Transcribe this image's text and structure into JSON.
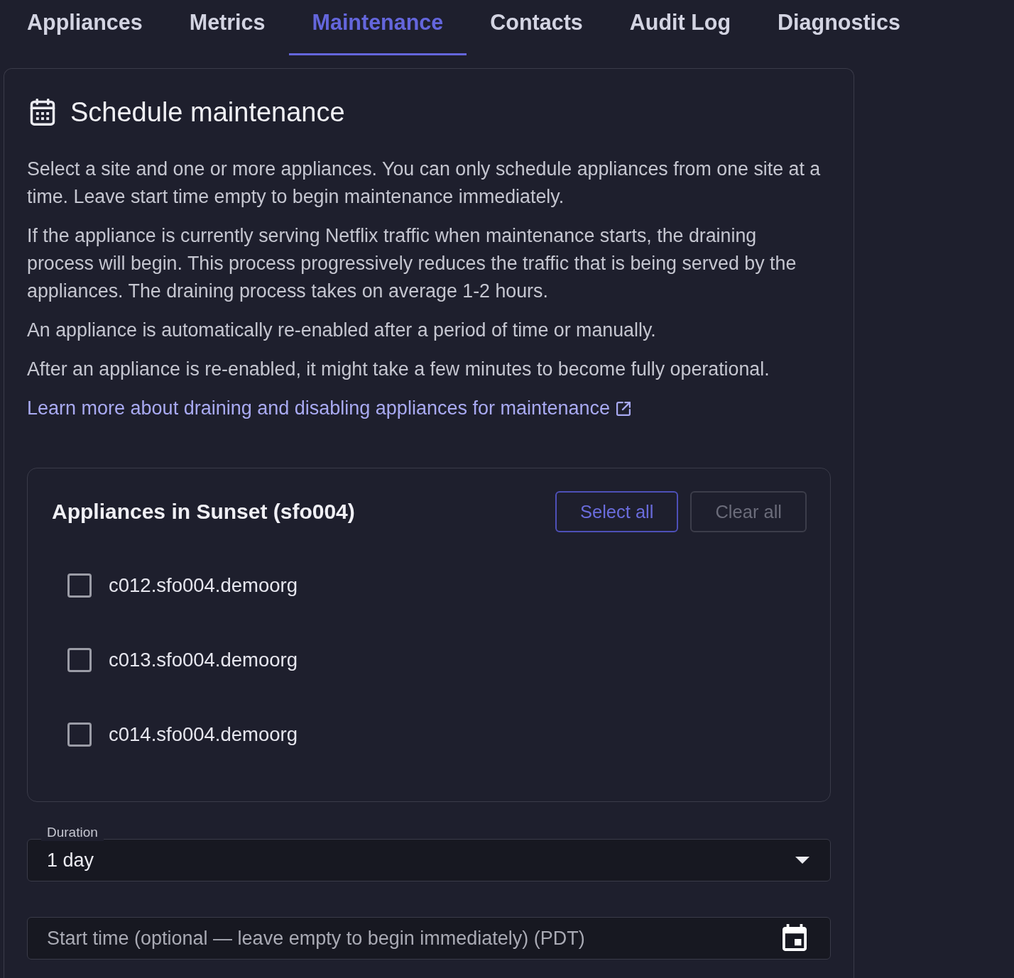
{
  "tabs": [
    {
      "label": "Appliances",
      "selected": false
    },
    {
      "label": "Metrics",
      "selected": false
    },
    {
      "label": "Maintenance",
      "selected": true
    },
    {
      "label": "Contacts",
      "selected": false
    },
    {
      "label": "Audit Log",
      "selected": false
    },
    {
      "label": "Diagnostics",
      "selected": false
    }
  ],
  "panel": {
    "title": "Schedule maintenance",
    "paragraphs": [
      "Select a site and one or more appliances. You can only schedule appliances from one site at a time. Leave start time empty to begin maintenance immediately.",
      "If the appliance is currently serving Netflix traffic when maintenance starts, the draining process will begin. This process progressively reduces the traffic that is being served by the appliances. The draining process takes on average 1-2 hours.",
      "An appliance is automatically re-enabled after a period of time or manually.",
      "After an appliance is re-enabled, it might take a few minutes to become fully operational."
    ],
    "link": {
      "label": "Learn more about draining and disabling appliances for maintenance"
    },
    "appliances": {
      "title": "Appliances in Sunset (sfo004)",
      "buttons": [
        {
          "label": "Select all",
          "disabled": false
        },
        {
          "label": "Clear all",
          "disabled": true
        }
      ],
      "items": [
        {
          "label": "c012.sfo004.demoorg",
          "checked": false
        },
        {
          "label": "c013.sfo004.demoorg",
          "checked": false
        },
        {
          "label": "c014.sfo004.demoorg",
          "checked": false
        }
      ]
    },
    "duration": {
      "label": "Duration",
      "value": "1 day"
    },
    "start_time": {
      "placeholder": "Start time (optional — leave empty to begin immediately) (PDT)"
    }
  }
}
